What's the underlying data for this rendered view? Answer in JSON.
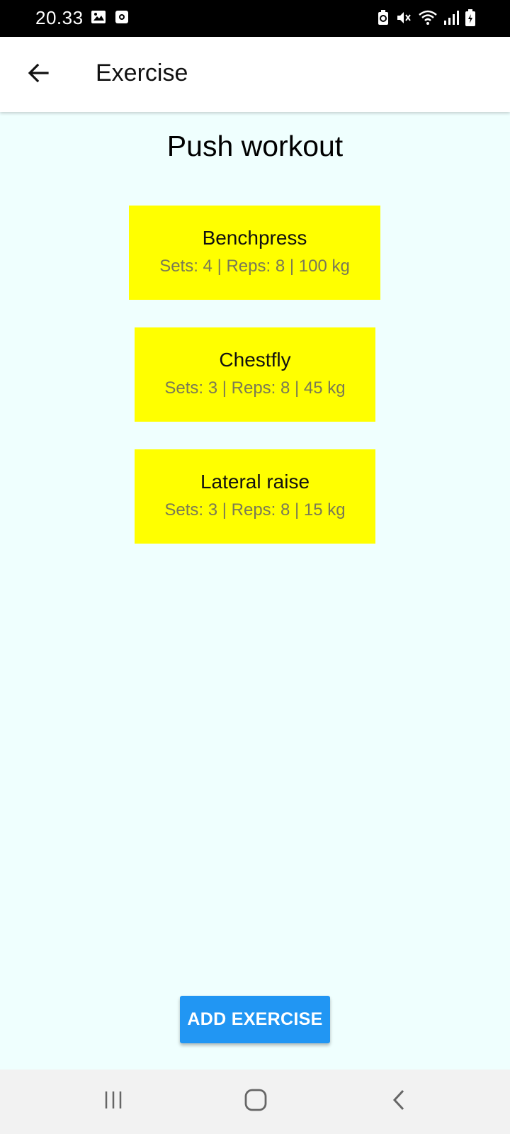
{
  "status_bar": {
    "time": "20.33",
    "icons_left": [
      "image-icon",
      "camera-icon"
    ],
    "icons_right": [
      "battery-saver-icon",
      "mute-icon",
      "wifi-icon",
      "signal-icon",
      "battery-charging-icon"
    ]
  },
  "app_bar": {
    "title": "Exercise",
    "back_icon": "arrow-left-icon"
  },
  "workout": {
    "title": "Push workout"
  },
  "exercises": [
    {
      "name": "Benchpress",
      "detail": "Sets: 4 | Reps: 8 | 100 kg"
    },
    {
      "name": "Chestfly",
      "detail": "Sets: 3 | Reps: 8 | 45 kg"
    },
    {
      "name": "Lateral raise",
      "detail": "Sets: 3 | Reps: 8 | 15 kg"
    }
  ],
  "actions": {
    "add_label": "ADD EXERCISE"
  },
  "nav_bar": {
    "icons": [
      "recents-icon",
      "home-icon",
      "back-icon"
    ]
  },
  "colors": {
    "background": "#effffe",
    "card": "#ffff00",
    "button": "#2196f3",
    "status_bar": "#000000"
  }
}
